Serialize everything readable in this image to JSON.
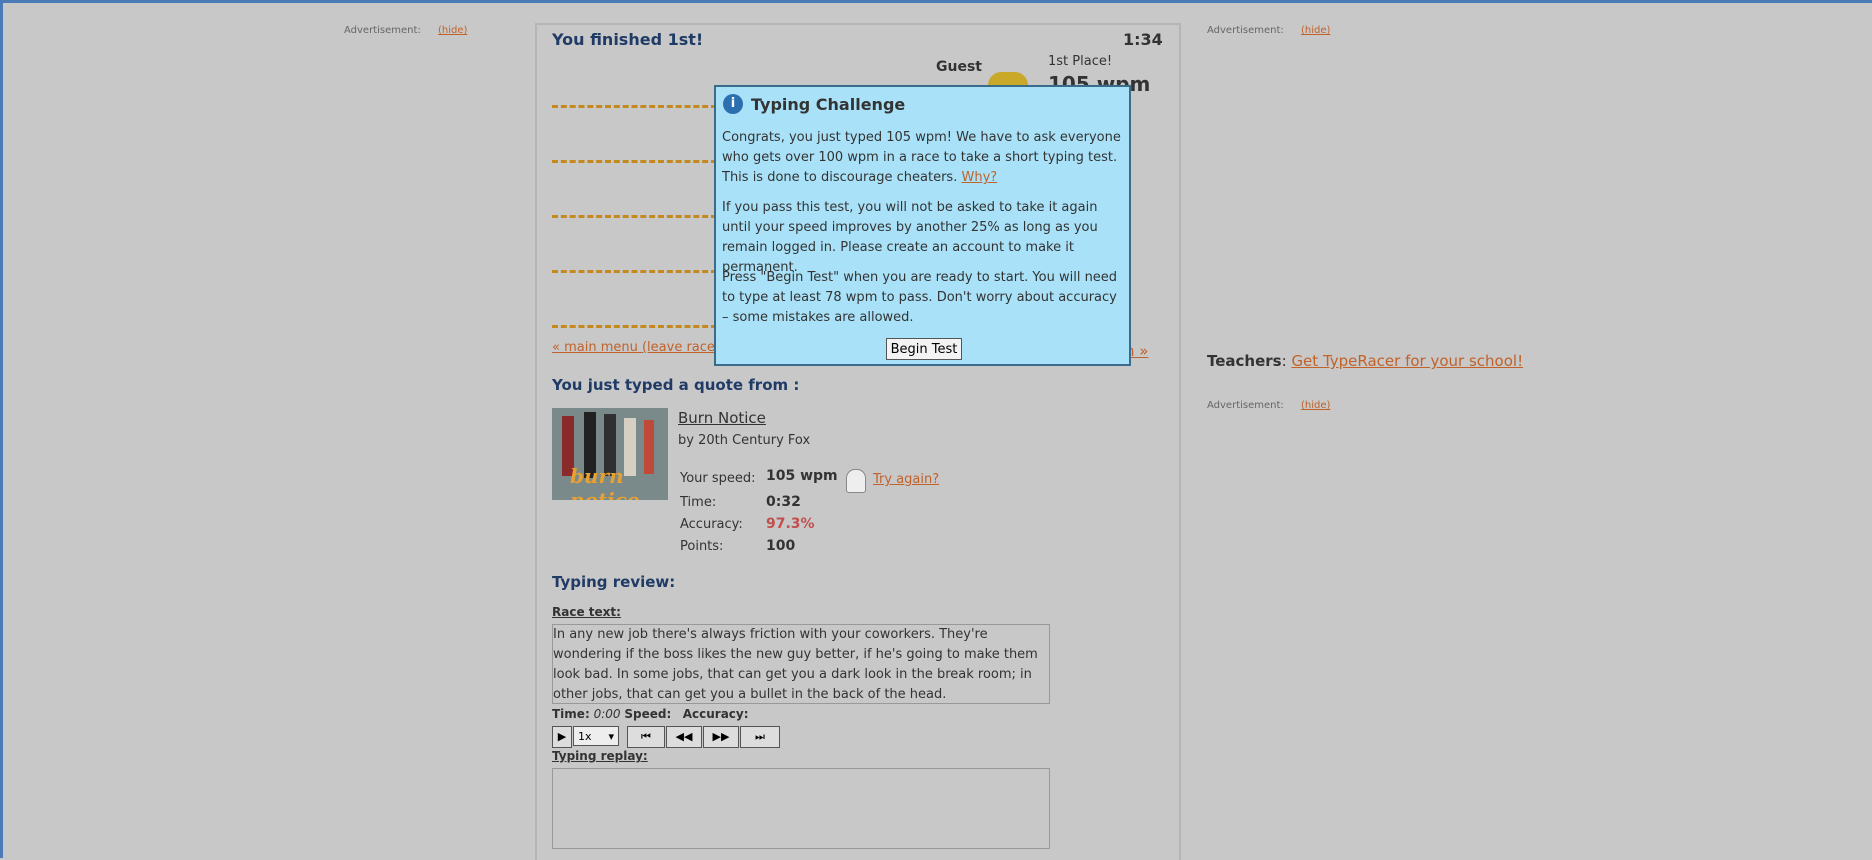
{
  "ads": {
    "label": "Advertisement:",
    "hide": "(hide)"
  },
  "race": {
    "finished_title": "You finished 1st!",
    "timer": "1:34",
    "player_name": "Guest",
    "place": "1st Place!",
    "speed_big": "105 wpm",
    "main_menu": "« main menu (leave race)",
    "next_race": "n »"
  },
  "quote": {
    "heading": "You just typed a quote from :",
    "title": "Burn Notice",
    "by": "by 20th Century Fox",
    "poster_logo": "burn notice"
  },
  "stats": {
    "speed_label": "Your speed:",
    "speed_value": "105 wpm",
    "try_again": "Try again?",
    "time_label": "Time:",
    "time_value": "0:32",
    "accuracy_label": "Accuracy:",
    "accuracy_value": "97.3%",
    "points_label": "Points:",
    "points_value": "100"
  },
  "review": {
    "heading": "Typing review:",
    "race_text_label": "Race text:",
    "race_text": "In any new job there's always friction with your coworkers. They're wondering if the boss likes the new guy better, if he's going to make them look bad. In some jobs, that can get you a dark look in the break room; in other jobs, that can get you a bullet in the back of the head.",
    "time_label": "Time:",
    "time_value": "0:00",
    "speed_label": "Speed:",
    "accuracy_label": "Accuracy:",
    "speed_select": "1x",
    "replay_label": "Typing replay:"
  },
  "teachers": {
    "label": "Teachers",
    "link": "Get TypeRacer for your school!"
  },
  "dialog": {
    "title": "Typing Challenge",
    "p1": "Congrats, you just typed 105 wpm! We have to ask everyone who gets over 100 wpm in a race to take a short typing test. This is done to discourage cheaters.",
    "why": "Why?",
    "p2": "If you pass this test, you will not be asked to take it again until your speed improves by another 25% as long as you remain logged in. Please create an account to make it permanent.",
    "p3": "Press \"Begin Test\" when you are ready to start. You will need to type at least 78 wpm to pass. Don't worry about accuracy – some mistakes are allowed.",
    "button": "Begin Test"
  }
}
